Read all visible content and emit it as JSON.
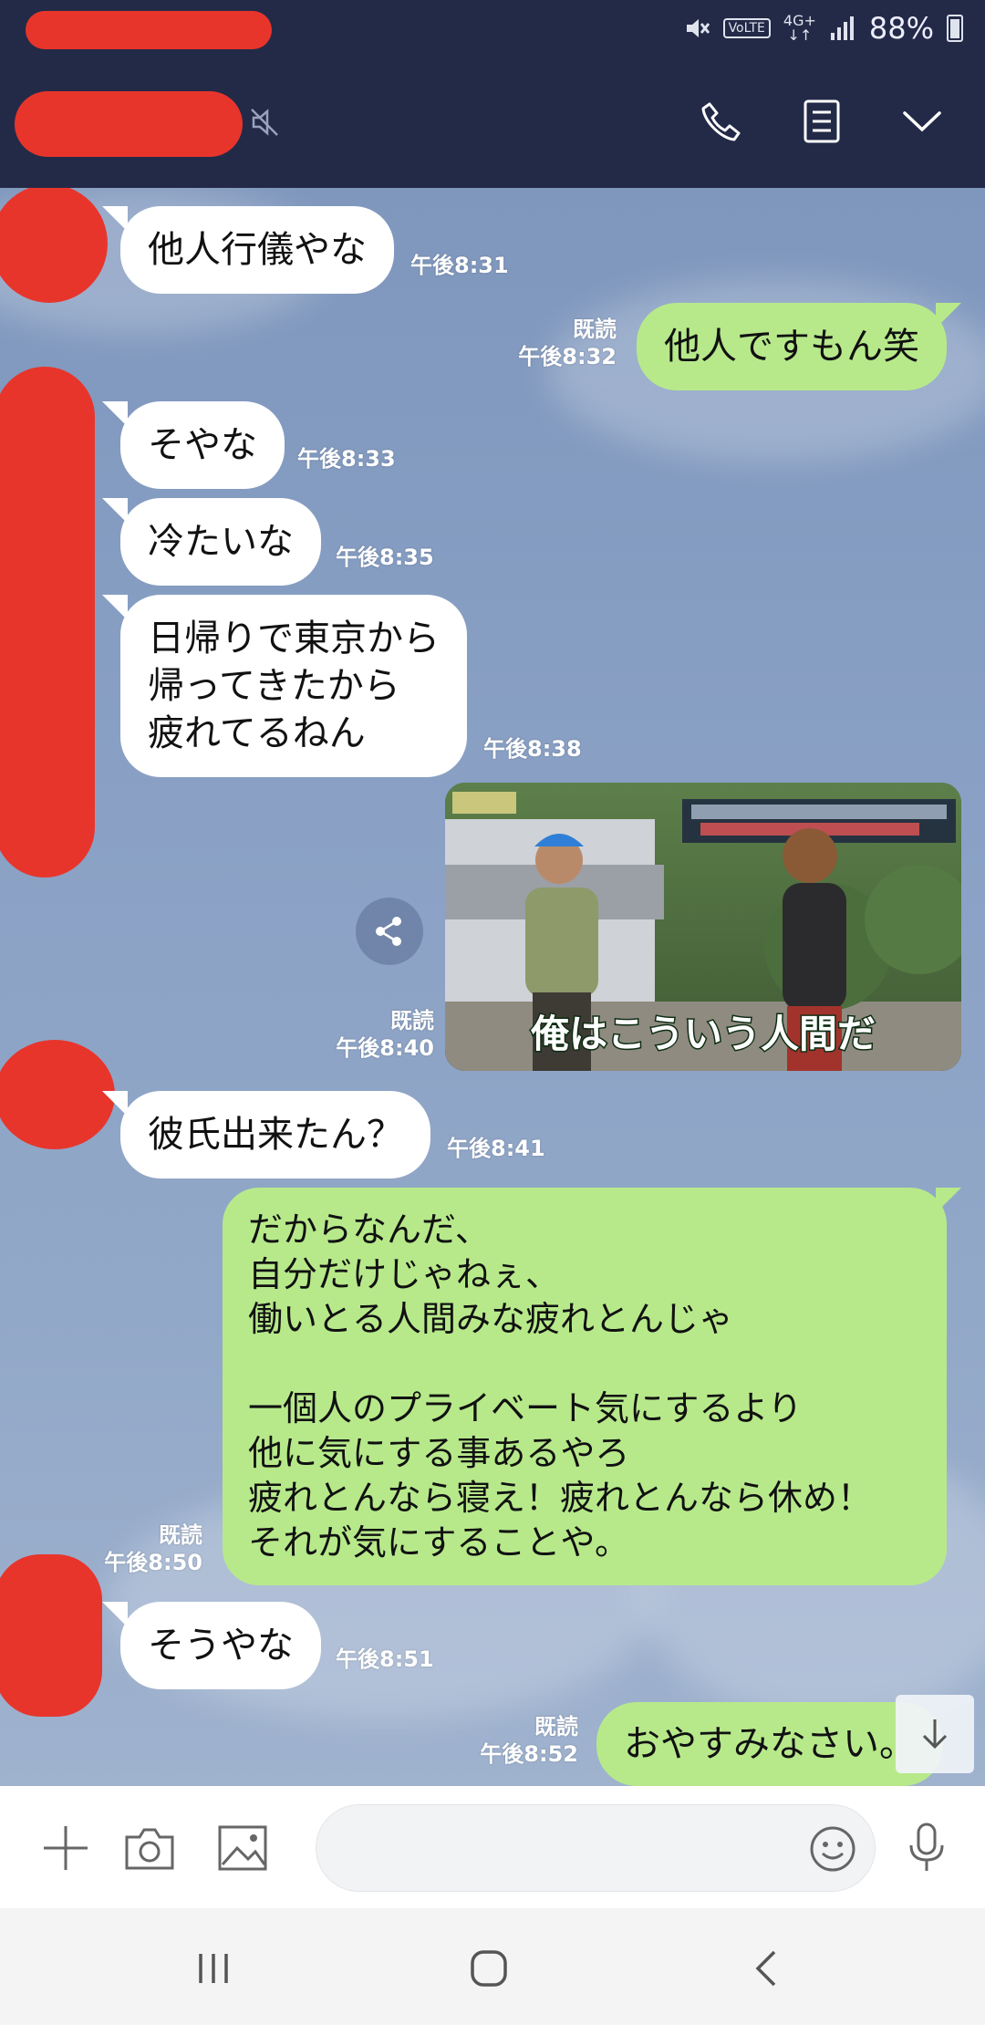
{
  "status_bar": {
    "battery": "88%",
    "network": "4G+",
    "volte": "VoLTE",
    "icons": [
      "mute-icon",
      "volte-icon",
      "network-icon",
      "signal-icon",
      "battery-icon"
    ]
  },
  "header": {
    "icons": [
      "muted-speaker-icon",
      "phone-icon",
      "notes-icon",
      "chevron-down-icon"
    ]
  },
  "messages": [
    {
      "dir": "in",
      "text": "他人行儀やな",
      "time": "午後8:31"
    },
    {
      "dir": "out",
      "text": "他人ですもん笑",
      "read": "既読",
      "time": "午後8:32"
    },
    {
      "dir": "in",
      "text": "そやな",
      "time": "午後8:33"
    },
    {
      "dir": "in",
      "text": "冷たいな",
      "time": "午後8:35"
    },
    {
      "dir": "in",
      "text": "日帰りで東京から\n帰ってきたから\n疲れてるねん",
      "time": "午後8:38"
    },
    {
      "dir": "out",
      "type": "image",
      "image_caption": "俺はこういう人間だ",
      "read": "既読",
      "time": "午後8:40"
    },
    {
      "dir": "in",
      "text": "彼氏出来たん？",
      "time": "午後8:41"
    },
    {
      "dir": "out",
      "text": "だからなんだ、\n自分だけじゃねぇ、\n働いとる人間みな疲れとんじゃ\n\n一個人のプライベート気にするより\n他に気にする事あるやろ\n疲れとんなら寝え！疲れとんなら休め！\nそれが気にすることや。",
      "read": "既読",
      "time": "午後8:50"
    },
    {
      "dir": "in",
      "text": "そうやな",
      "time": "午後8:51"
    },
    {
      "dir": "out",
      "text": "おやすみなさい。",
      "read": "既読",
      "time": "午後8:52"
    }
  ],
  "input_bar": {
    "icons": [
      "plus-icon",
      "camera-icon",
      "image-icon",
      "emoji-icon",
      "microphone-icon"
    ]
  },
  "colors": {
    "header_bg": "#232a47",
    "outgoing_bubble": "#b7e98b",
    "incoming_bubble": "#ffffff",
    "redaction": "#e8352c"
  }
}
